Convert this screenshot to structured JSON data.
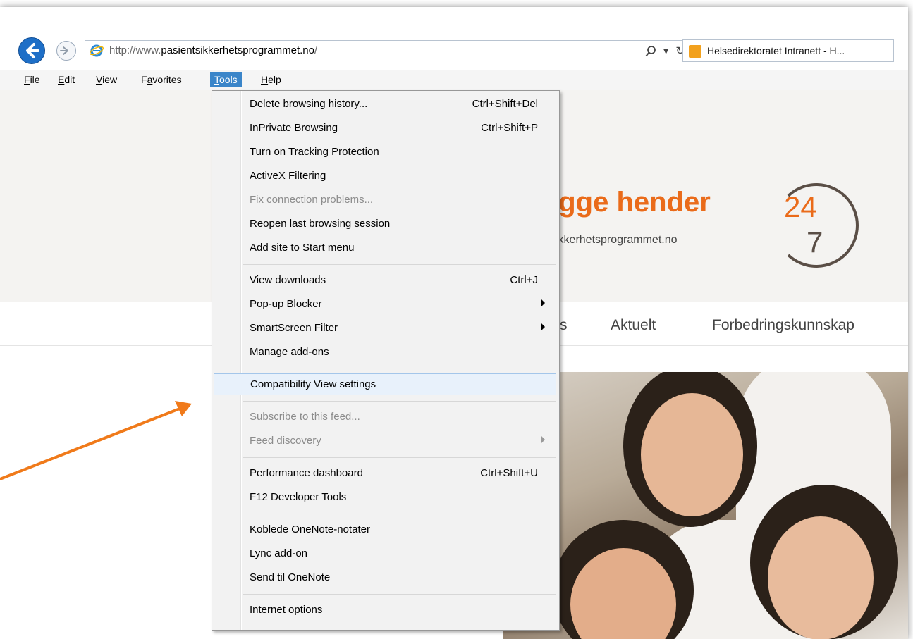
{
  "browser": {
    "url_prefix": "http://www.",
    "url_domain": "pasientsikkerhetsprogrammet.no",
    "url_suffix": "/",
    "search_icon": "search-icon",
    "dropdown_glyph": "▾",
    "refresh_glyph": "↻",
    "tab_title": "Helsedirektoratet Intranett - H..."
  },
  "menubar": {
    "items": [
      {
        "pre": "",
        "u": "F",
        "post": "ile"
      },
      {
        "pre": "",
        "u": "E",
        "post": "dit"
      },
      {
        "pre": "",
        "u": "V",
        "post": "iew"
      },
      {
        "pre": "F",
        "u": "a",
        "post": "vorites"
      },
      {
        "pre": "",
        "u": "T",
        "post": "ools"
      },
      {
        "pre": "",
        "u": "H",
        "post": "elp"
      }
    ]
  },
  "page": {
    "logo_text": "ygge hender",
    "logo_sub": "sikkerhetsprogrammet.no",
    "logo_24": "24",
    "logo_7": "7",
    "nav_partial": "s",
    "nav_aktuelt": "Aktuelt",
    "nav_forbedring": "Forbedringskunnskap"
  },
  "tools_menu": {
    "items": [
      {
        "label": "Delete browsing history...",
        "shortcut": "Ctrl+Shift+Del"
      },
      {
        "label": "InPrivate Browsing",
        "shortcut": "Ctrl+Shift+P"
      },
      {
        "label": "Turn on Tracking Protection",
        "shortcut": ""
      },
      {
        "label": "ActiveX Filtering",
        "shortcut": ""
      },
      {
        "label": "Fix connection problems...",
        "shortcut": ""
      },
      {
        "label": "Reopen last browsing session",
        "shortcut": ""
      },
      {
        "label": "Add site to Start menu",
        "shortcut": ""
      },
      {
        "label": "View downloads",
        "shortcut": "Ctrl+J"
      },
      {
        "label": "Pop-up Blocker",
        "shortcut": ""
      },
      {
        "label": "SmartScreen Filter",
        "shortcut": ""
      },
      {
        "label": "Manage add-ons",
        "shortcut": ""
      },
      {
        "label": "Compatibility View settings",
        "shortcut": ""
      },
      {
        "label": "Subscribe to this feed...",
        "shortcut": ""
      },
      {
        "label": "Feed discovery",
        "shortcut": ""
      },
      {
        "label": "Performance dashboard",
        "shortcut": "Ctrl+Shift+U"
      },
      {
        "label": "F12 Developer Tools",
        "shortcut": ""
      },
      {
        "label": "Koblede OneNote-notater",
        "shortcut": ""
      },
      {
        "label": "Lync add-on",
        "shortcut": ""
      },
      {
        "label": "Send til OneNote",
        "shortcut": ""
      },
      {
        "label": "Internet options",
        "shortcut": ""
      }
    ]
  },
  "colors": {
    "menu_active": "#3a85c9",
    "highlight": "#e8f1fb",
    "arrow": "#f07a1a",
    "brand_orange": "#ea6b1a"
  }
}
